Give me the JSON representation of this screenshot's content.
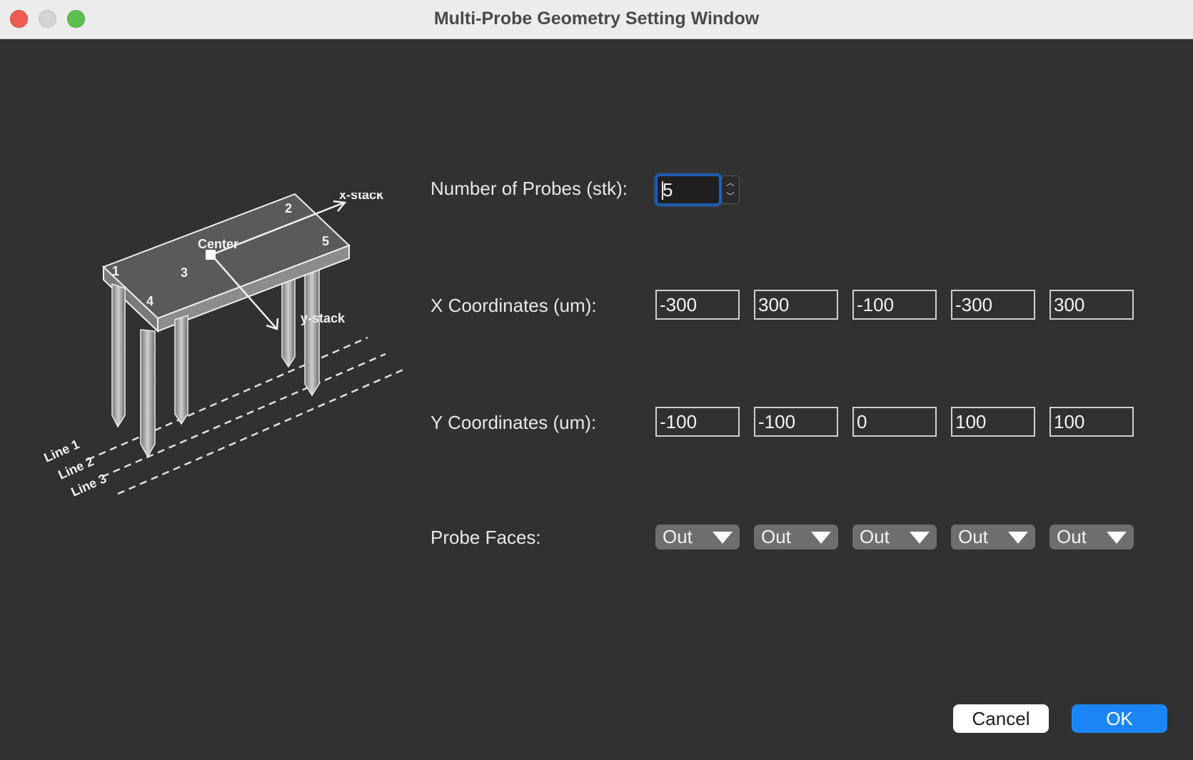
{
  "window": {
    "title": "Multi-Probe Geometry Setting Window"
  },
  "diagram": {
    "labels": {
      "x_stack": "x-stack",
      "y_stack": "y-stack",
      "center": "Center",
      "line1": "Line 1",
      "line2": "Line 2",
      "line3": "Line 3",
      "p1": "1",
      "p2": "2",
      "p3": "3",
      "p4": "4",
      "p5": "5"
    }
  },
  "form": {
    "num_probes_label": "Number of Probes (stk):",
    "num_probes_value": "5",
    "x_label": "X Coordinates (um):",
    "x_values": [
      "-300",
      "300",
      "-100",
      "-300",
      "300"
    ],
    "y_label": "Y Coordinates (um):",
    "y_values": [
      "-100",
      "-100",
      "0",
      "100",
      "100"
    ],
    "faces_label": "Probe Faces:",
    "faces": [
      "Out",
      "Out",
      "Out",
      "Out",
      "Out"
    ]
  },
  "buttons": {
    "cancel": "Cancel",
    "ok": "OK"
  },
  "colors": {
    "background": "#313131",
    "accent": "#1c85f5",
    "focus": "#1d5fb8"
  },
  "icons": {
    "stepper_up": "chevron-up-icon",
    "stepper_down": "chevron-down-icon",
    "dropdown": "triangle-down-icon"
  }
}
